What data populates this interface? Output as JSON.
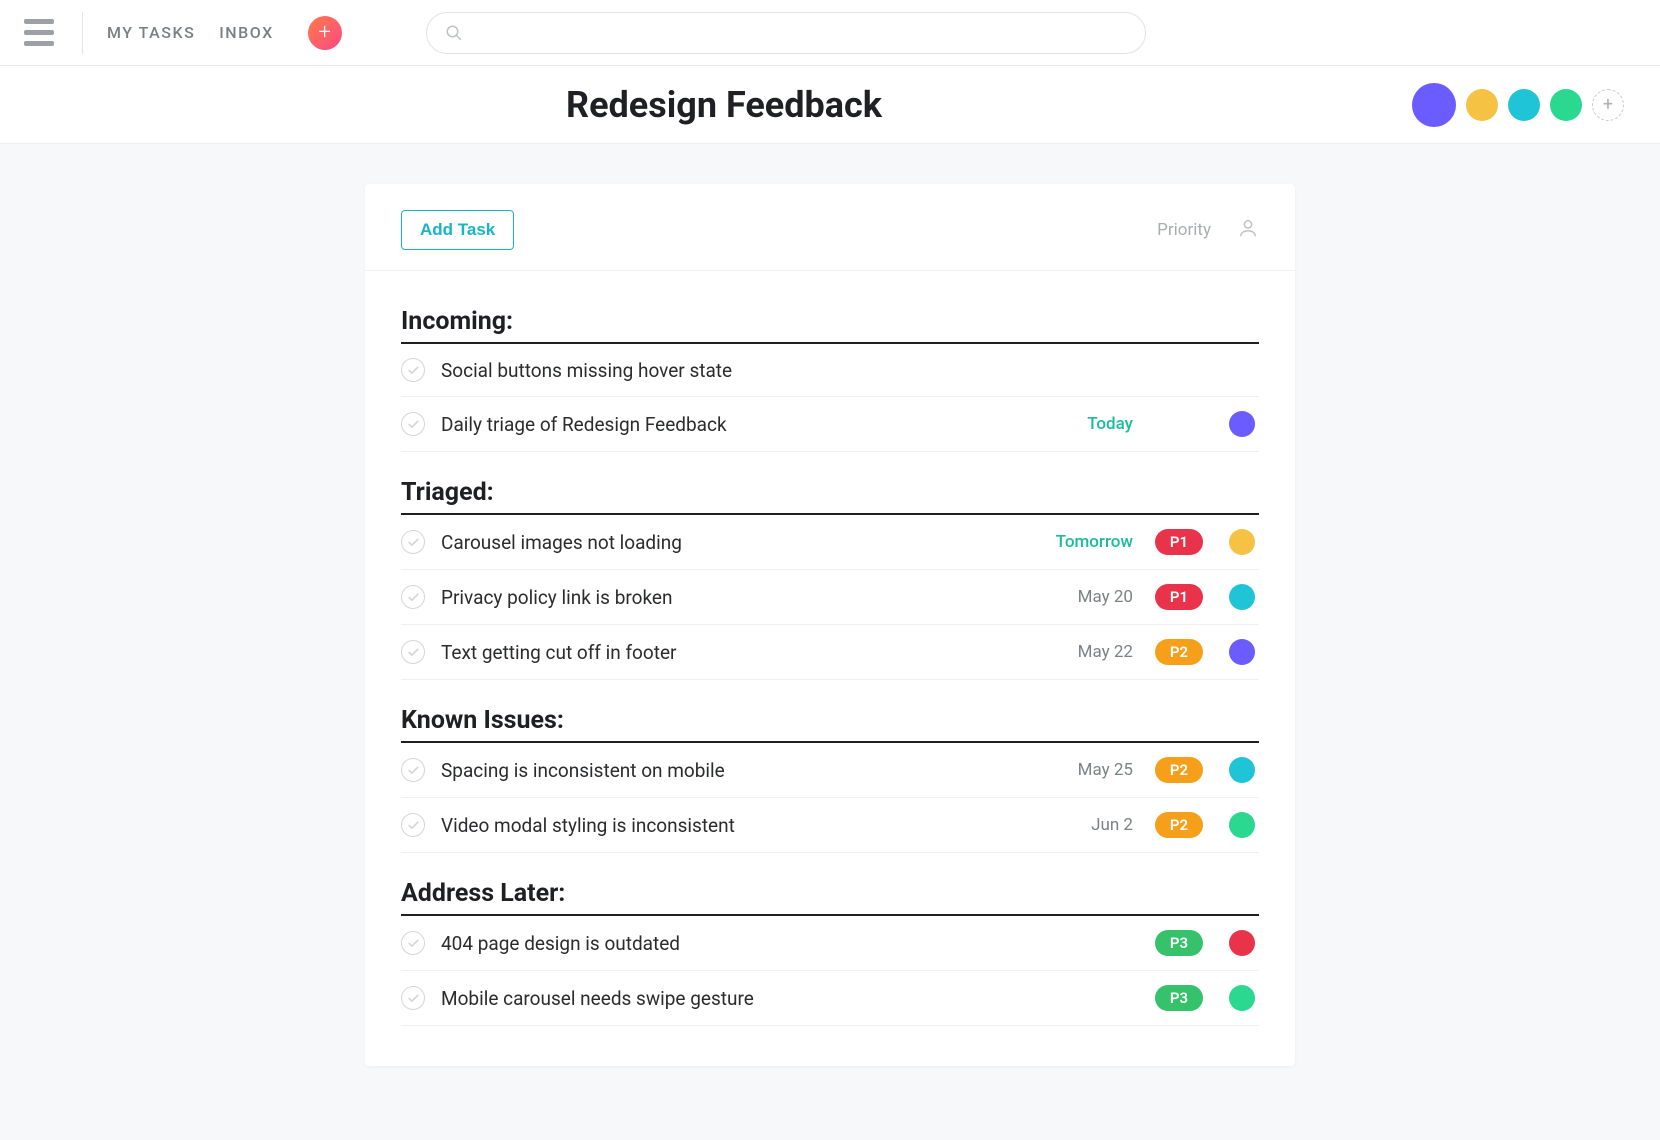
{
  "nav": {
    "my_tasks": "MY TASKS",
    "inbox": "INBOX"
  },
  "search": {
    "placeholder": ""
  },
  "header": {
    "title": "Redesign Feedback",
    "members": [
      {
        "color": "#6a5cff"
      },
      {
        "color": "#f6c243"
      },
      {
        "color": "#1fc4d6"
      },
      {
        "color": "#2bd88f"
      }
    ]
  },
  "toolbar": {
    "add_task": "Add Task",
    "priority_label": "Priority"
  },
  "priority_colors": {
    "P1": "#e8334b",
    "P2": "#f59f1a",
    "P3": "#35c26b"
  },
  "sections": [
    {
      "title": "Incoming:",
      "tasks": [
        {
          "title": "Social buttons missing hover state",
          "date": "",
          "date_kind": "",
          "priority": "",
          "assignee_color": ""
        },
        {
          "title": "Daily triage of Redesign Feedback",
          "date": "Today",
          "date_kind": "today",
          "priority": "",
          "assignee_color": "#6a5cff"
        }
      ]
    },
    {
      "title": "Triaged:",
      "tasks": [
        {
          "title": "Carousel images not loading",
          "date": "Tomorrow",
          "date_kind": "tomorrow",
          "priority": "P1",
          "assignee_color": "#f6c243"
        },
        {
          "title": "Privacy policy link is broken",
          "date": "May 20",
          "date_kind": "",
          "priority": "P1",
          "assignee_color": "#1fc4d6"
        },
        {
          "title": "Text getting cut off in footer",
          "date": "May 22",
          "date_kind": "",
          "priority": "P2",
          "assignee_color": "#6a5cff"
        }
      ]
    },
    {
      "title": "Known Issues:",
      "tasks": [
        {
          "title": "Spacing is inconsistent on mobile",
          "date": "May 25",
          "date_kind": "",
          "priority": "P2",
          "assignee_color": "#1fc4d6"
        },
        {
          "title": "Video modal styling is inconsistent",
          "date": "Jun 2",
          "date_kind": "",
          "priority": "P2",
          "assignee_color": "#2bd88f"
        }
      ]
    },
    {
      "title": "Address Later:",
      "tasks": [
        {
          "title": "404 page design is outdated",
          "date": "",
          "date_kind": "",
          "priority": "P3",
          "assignee_color": "#e8334b"
        },
        {
          "title": "Mobile carousel needs swipe gesture",
          "date": "",
          "date_kind": "",
          "priority": "P3",
          "assignee_color": "#2bd88f"
        }
      ]
    }
  ]
}
